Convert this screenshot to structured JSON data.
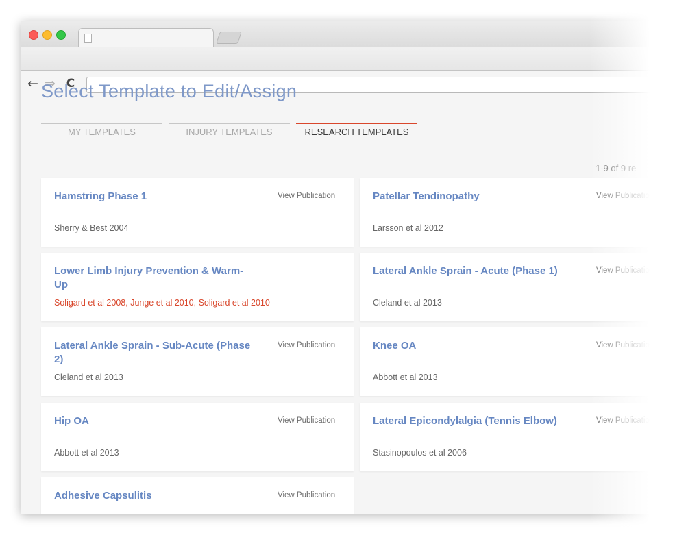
{
  "page": {
    "title": "Select Template to Edit/Assign",
    "tabs": [
      {
        "label": "MY TEMPLATES"
      },
      {
        "label": "INJURY TEMPLATES"
      },
      {
        "label": "RESEARCH TEMPLATES"
      }
    ],
    "active_tab": "RESEARCH TEMPLATES",
    "result_count": "1-9 of 9 re"
  },
  "browser": {
    "back_icon": "←",
    "forward_icon": "⇒",
    "reload_icon": "C",
    "address": ""
  },
  "templates": [
    {
      "title": "Hamstring Phase 1",
      "link": "View Publication",
      "authors": "Sherry & Best 2004"
    },
    {
      "title": "Patellar Tendinopathy",
      "link": "View Publication",
      "authors": "Larsson et al 2012"
    },
    {
      "title": "Lower Limb Injury Prevention & Warm-Up",
      "link": "",
      "authors": "Soligard et al 2008, Junge et al 2010, Soligard et al 2010"
    },
    {
      "title": "Lateral Ankle Sprain - Acute (Phase 1)",
      "link": "View Publication",
      "authors": "Cleland et al 2013"
    },
    {
      "title": "Lateral Ankle Sprain - Sub-Acute (Phase 2)",
      "link": "View Publication",
      "authors": "Cleland et al 2013"
    },
    {
      "title": "Knee OA",
      "link": "View Publication",
      "authors": "Abbott et al 2013"
    },
    {
      "title": "Hip OA",
      "link": "View Publication",
      "authors": "Abbott et al 2013"
    },
    {
      "title": "Lateral Epicondylalgia (Tennis Elbow)",
      "link": "View Publication",
      "authors": "Stasinopoulos et al 2006"
    },
    {
      "title": "Adhesive Capsulitis",
      "link": "View Publication",
      "authors": ""
    }
  ],
  "colors": {
    "accent": "#d9472c",
    "title_blue": "#7e98c8",
    "link_blue": "#6687c2"
  }
}
